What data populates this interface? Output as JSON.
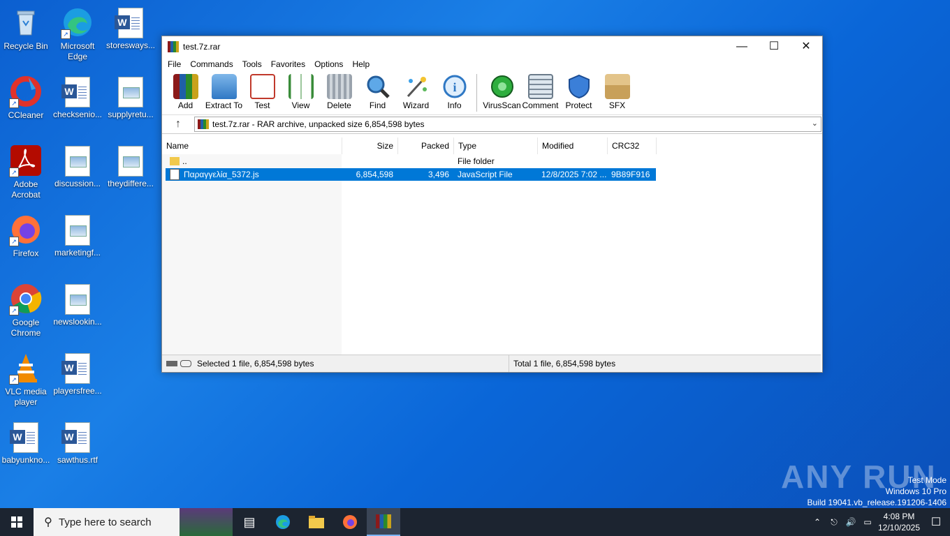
{
  "desktop": {
    "icons": [
      {
        "label": "Recycle Bin",
        "icon": "recycle-bin-icon"
      },
      {
        "label": "Microsoft Edge",
        "icon": "edge-icon"
      },
      {
        "label": "storesways...",
        "icon": "word-doc-icon"
      },
      {
        "label": "CCleaner",
        "icon": "ccleaner-icon"
      },
      {
        "label": "checksenio...",
        "icon": "word-doc-icon"
      },
      {
        "label": "supplyretu...",
        "icon": "image-file-icon"
      },
      {
        "label": "Adobe Acrobat",
        "icon": "acrobat-icon"
      },
      {
        "label": "discussion...",
        "icon": "image-file-icon"
      },
      {
        "label": "theydiffere...",
        "icon": "image-file-icon"
      },
      {
        "label": "Firefox",
        "icon": "firefox-icon"
      },
      {
        "label": "marketingf...",
        "icon": "image-file-icon"
      },
      {
        "label": "Google Chrome",
        "icon": "chrome-icon"
      },
      {
        "label": "newslookin...",
        "icon": "image-file-icon"
      },
      {
        "label": "VLC media player",
        "icon": "vlc-icon"
      },
      {
        "label": "playersfree...",
        "icon": "word-doc-icon"
      },
      {
        "label": "babyunkno...",
        "icon": "word-doc-icon"
      },
      {
        "label": "sawthus.rtf",
        "icon": "word-doc-icon"
      }
    ]
  },
  "window": {
    "title": "test.7z.rar",
    "menu": [
      "File",
      "Commands",
      "Tools",
      "Favorites",
      "Options",
      "Help"
    ],
    "toolbar": [
      "Add",
      "Extract To",
      "Test",
      "View",
      "Delete",
      "Find",
      "Wizard",
      "Info",
      "VirusScan",
      "Comment",
      "Protect",
      "SFX"
    ],
    "address": "test.7z.rar - RAR archive, unpacked size 6,854,598 bytes",
    "columns": {
      "name": "Name",
      "size": "Size",
      "packed": "Packed",
      "type": "Type",
      "modified": "Modified",
      "crc": "CRC32"
    },
    "rows": [
      {
        "name": "..",
        "size": "",
        "packed": "",
        "type": "File folder",
        "modified": "",
        "crc": ""
      },
      {
        "name": "Παραγγελία_5372.js",
        "size": "6,854,598",
        "packed": "3,496",
        "type": "JavaScript File",
        "modified": "12/8/2025 7:02 ...",
        "crc": "9B89F916"
      }
    ],
    "status_left": "Selected 1 file, 6,854,598 bytes",
    "status_right": "Total 1 file, 6,854,598 bytes"
  },
  "taskbar": {
    "search_placeholder": "Type here to search",
    "time": "4:08 PM",
    "date": "12/10/2025"
  },
  "watermark": {
    "line1": "Test Mode",
    "line2": "Windows 10 Pro",
    "line3": "Build 19041.vb_release.191206-1406",
    "brand": "ANY RUN"
  }
}
